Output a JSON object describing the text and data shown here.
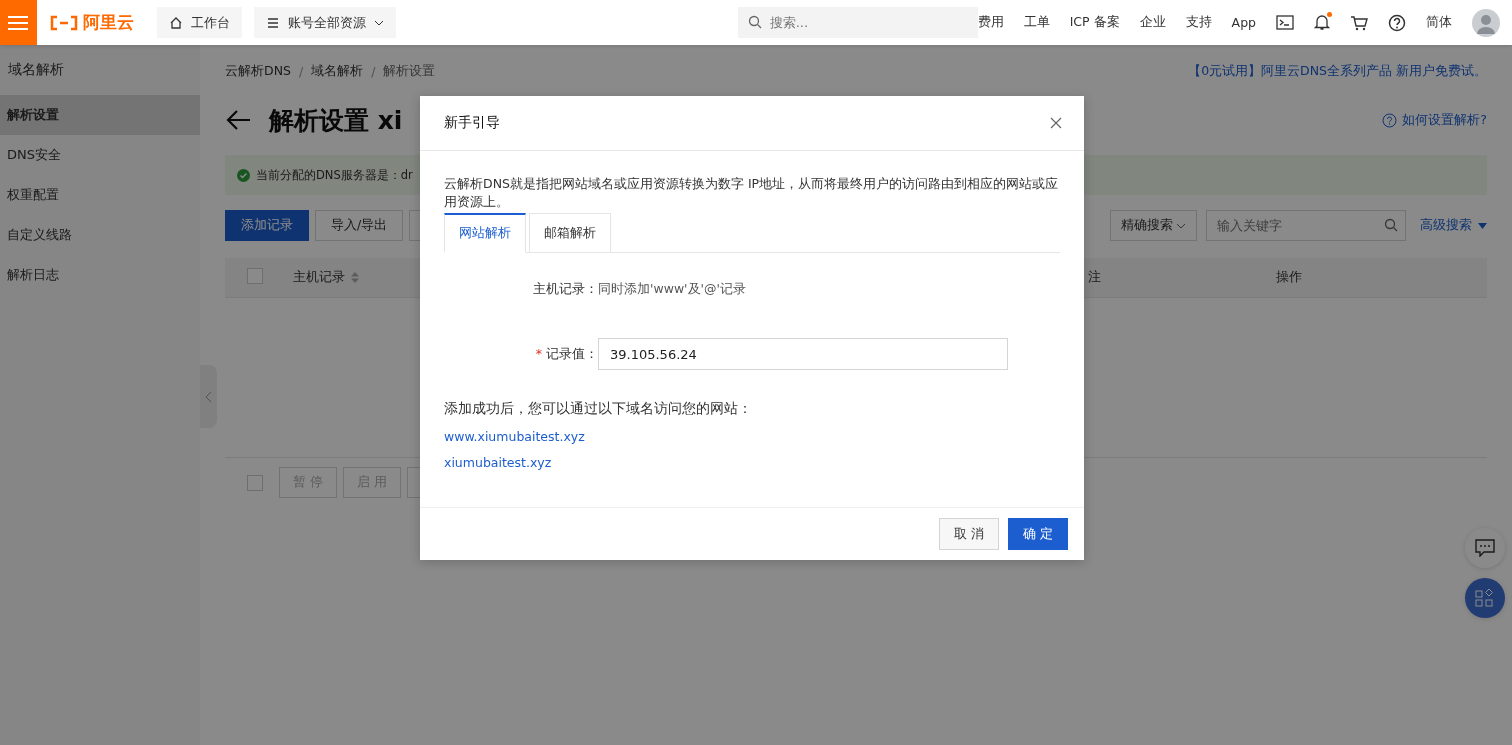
{
  "topbar": {
    "logo_text": "阿里云",
    "workbench": "工作台",
    "resources": "账号全部资源",
    "search_placeholder": "搜索...",
    "links": [
      "费用",
      "工单",
      "ICP 备案",
      "企业",
      "支持",
      "App"
    ],
    "has_notification": true,
    "language": "简体"
  },
  "sidebar": {
    "title": "域名解析",
    "items": [
      {
        "label": "解析设置",
        "selected": true
      },
      {
        "label": "DNS安全",
        "selected": false
      },
      {
        "label": "权重配置",
        "selected": false
      },
      {
        "label": "自定义线路",
        "selected": false
      },
      {
        "label": "解析日志",
        "selected": false
      }
    ]
  },
  "breadcrumb": [
    "云解析DNS",
    "域名解析",
    "解析设置"
  ],
  "breadcrumb_separator": "/",
  "promo_link": "【0元试用】阿里云DNS全系列产品 新用户免费试。",
  "page_title": "解析设置 xi",
  "help_link": "如何设置解析?",
  "notice": "当前分配的DNS服务器是：dr",
  "toolbar": {
    "buttons": [
      {
        "label": "添加记录",
        "kind": "primary"
      },
      {
        "label": "导入/导出",
        "kind": "default"
      }
    ],
    "search_mode": "精确搜索",
    "search_placeholder": "输入关键字",
    "advanced_search": "高级搜索"
  },
  "table": {
    "select_all_checked": false,
    "columns": [
      "主机记录",
      "注",
      "操作"
    ]
  },
  "batch_select_checked": false,
  "batch_buttons": [
    {
      "label": "暂 停",
      "disabled": true
    },
    {
      "label": "启 用",
      "disabled": true
    }
  ],
  "modal": {
    "title": "新手引导",
    "description": "云解析DNS就是指把网站域名或应用资源转换为数字 IP地址，从而将最终用户的访问路由到相应的网站或应用资源上。",
    "tabs": [
      {
        "label": "网站解析",
        "selected": true
      },
      {
        "label": "邮箱解析",
        "selected": false
      }
    ],
    "host_label": "主机记录：",
    "host_value": "同时添加'www'及'@'记录",
    "value_label": "记录值：",
    "required_mark": "*",
    "value": "39.105.56.24",
    "result_text": "添加成功后，您可以通过以下域名访问您的网站：",
    "links": [
      "www.xiumubaitest.xyz",
      "xiumubaitest.xyz"
    ],
    "buttons": [
      {
        "label": "取 消",
        "kind": "default"
      },
      {
        "label": "确 定",
        "kind": "primary"
      }
    ]
  }
}
